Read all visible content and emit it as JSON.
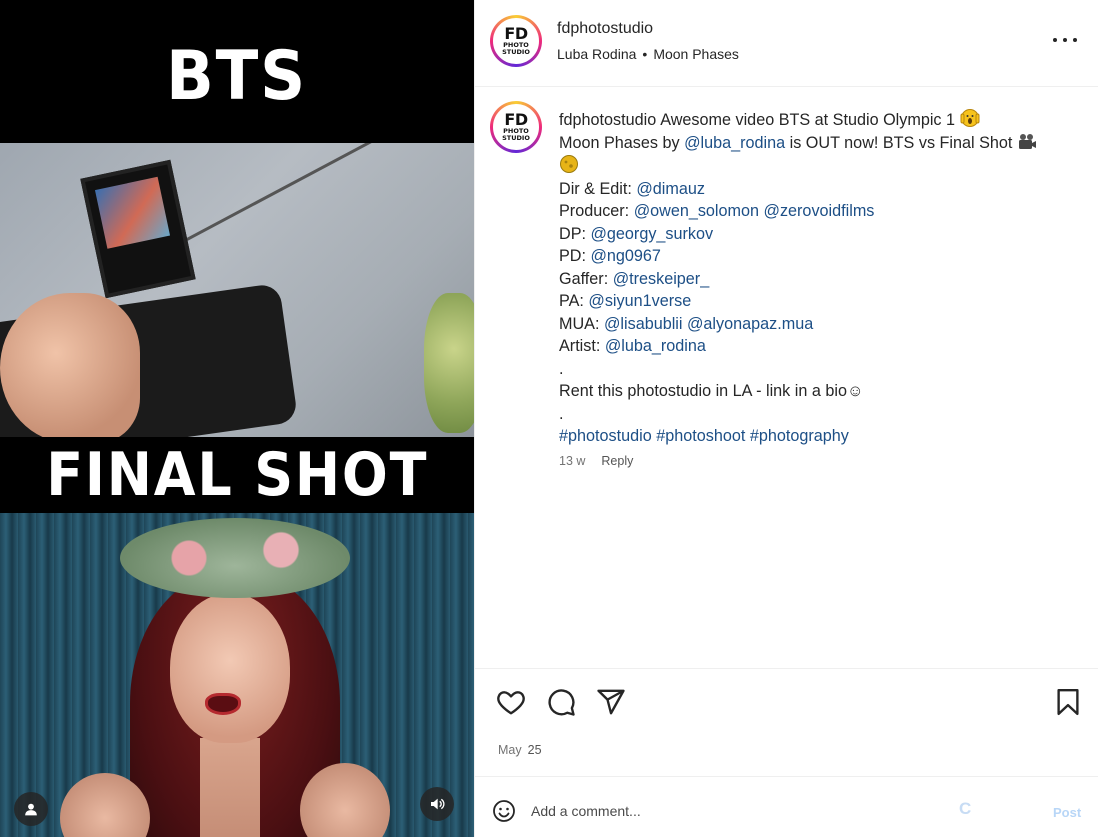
{
  "media": {
    "top_overlay_text": "BTS",
    "middle_overlay_text": "FINAL SHOT",
    "user_tag_icon": "person-icon",
    "audio_icon": "speaker-icon"
  },
  "header": {
    "avatar_line1": "FD",
    "avatar_line2": "PHOTO",
    "avatar_line3": "STUDIO",
    "username": "fdphotostudio",
    "audio_artist": "Luba Rodina",
    "separator": "•",
    "audio_title": "Moon Phases",
    "more_icon": "more-horizontal-icon"
  },
  "caption": {
    "username": "fdphotostudio",
    "line1": "Awesome video BTS at Studio Olympic 1",
    "line2_pre": "Moon Phases by ",
    "line2_link": "@luba_rodina",
    "line2_post": " is OUT now! BTS vs Final Shot ",
    "credits": [
      {
        "label": "Dir & Edit: ",
        "links": [
          "@dimauz"
        ]
      },
      {
        "label": "Producer: ",
        "links": [
          "@owen_solomon",
          "@zerovoidfilms"
        ]
      },
      {
        "label": "DP: ",
        "links": [
          "@georgy_surkov"
        ]
      },
      {
        "label": "PD: ",
        "links": [
          "@ng0967"
        ]
      },
      {
        "label": "Gaffer: ",
        "links": [
          "@treskeiper_"
        ]
      },
      {
        "label": "PA: ",
        "links": [
          "@siyun1verse"
        ]
      },
      {
        "label": "MUA: ",
        "links": [
          "@lisabublii",
          "@alyonapaz.mua"
        ]
      },
      {
        "label": "Artist: ",
        "links": [
          "@luba_rodina"
        ]
      }
    ],
    "dot1": ".",
    "rent_line": "Rent this photostudio in LA - link in a bio☺",
    "dot2": ".",
    "hashtags": [
      "#photostudio",
      "#photoshoot",
      "#photography"
    ],
    "age": "13 w",
    "reply_label": "Reply"
  },
  "actions": {
    "like_icon": "heart-icon",
    "comment_icon": "comment-icon",
    "share_icon": "send-icon",
    "save_icon": "bookmark-icon",
    "date_month": "May",
    "date_day": "25"
  },
  "composer": {
    "emoji_icon": "smiley-icon",
    "placeholder": "Add a comment...",
    "spinner_char": "C",
    "post_label": "Post"
  },
  "colors": {
    "link": "#1d4f86",
    "muted": "#737373",
    "post_disabled": "#b8d6f7"
  }
}
